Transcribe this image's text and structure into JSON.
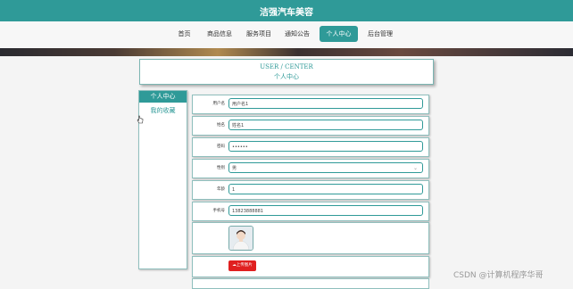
{
  "site": {
    "title": "洁强汽车美容"
  },
  "nav": {
    "items": [
      {
        "label": "首页",
        "active": false
      },
      {
        "label": "商品信息",
        "active": false
      },
      {
        "label": "服务项目",
        "active": false
      },
      {
        "label": "通知公告",
        "active": false
      },
      {
        "label": "个人中心",
        "active": true
      },
      {
        "label": "后台管理",
        "active": false
      }
    ]
  },
  "header": {
    "title_en": "USER / CENTER",
    "title_cn": "个人中心"
  },
  "sidebar": {
    "items": [
      {
        "label": "个人中心",
        "active": true
      },
      {
        "label": "我的收藏",
        "active": false
      }
    ]
  },
  "form": {
    "fields": [
      {
        "label": "用户名",
        "value": "用户名1"
      },
      {
        "label": "姓名",
        "value": "姓名1"
      },
      {
        "label": "密码",
        "value": "••••••"
      },
      {
        "label": "性别",
        "value": "男"
      },
      {
        "label": "年龄",
        "value": "1"
      },
      {
        "label": "手机号",
        "value": "13823888881"
      }
    ],
    "upload_label": "上传图片"
  },
  "watermark": "CSDN @计算机程序华哥",
  "colors": {
    "accent": "#2f9a98",
    "upload": "#e02020"
  }
}
